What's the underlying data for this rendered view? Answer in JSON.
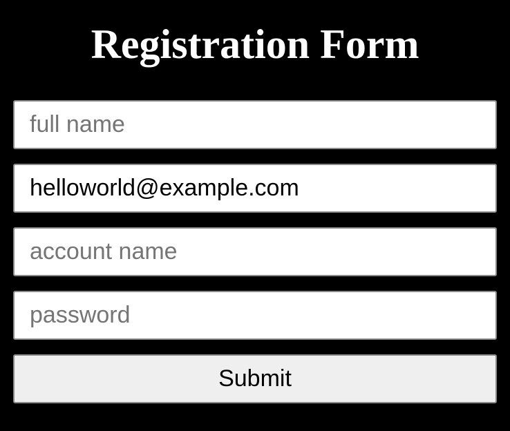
{
  "form": {
    "title": "Registration Form",
    "full_name": {
      "value": "",
      "placeholder": "full name"
    },
    "email": {
      "value": "helloworld@example.com",
      "placeholder": ""
    },
    "account_name": {
      "value": "",
      "placeholder": "account name"
    },
    "password": {
      "value": "",
      "placeholder": "password"
    },
    "submit_label": "Submit"
  },
  "colors": {
    "background": "#000000",
    "title": "#ffffff",
    "field_background": "#ffffff",
    "field_border": "#8a8a8a",
    "placeholder": "#757575",
    "button_background": "#efefef"
  }
}
